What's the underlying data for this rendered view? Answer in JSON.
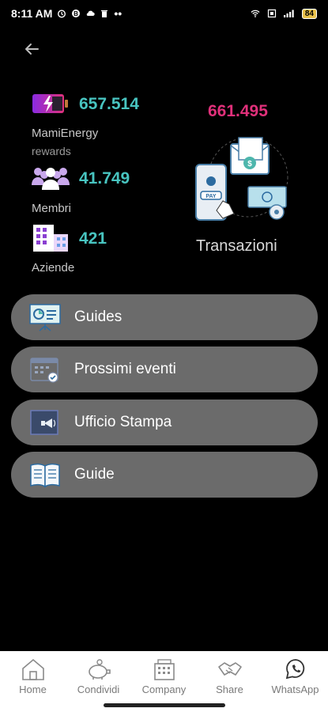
{
  "status": {
    "time": "8:11 AM",
    "battery": "84"
  },
  "stats": {
    "energy": {
      "value": "657.514",
      "label": "MamiEnergy",
      "sublabel": "rewards"
    },
    "members": {
      "value": "41.749",
      "label": "Membri"
    },
    "companies": {
      "value": "421",
      "label": "Aziende"
    }
  },
  "transactions": {
    "value": "661.495",
    "label": "Transazioni"
  },
  "menu": [
    {
      "label": "Guides",
      "icon": "presentation-board-icon"
    },
    {
      "label": "Prossimi eventi",
      "icon": "calendar-check-icon"
    },
    {
      "label": "Ufficio Stampa",
      "icon": "press-megaphone-icon"
    },
    {
      "label": "Guide",
      "icon": "open-book-icon"
    }
  ],
  "bottom_nav": [
    {
      "label": "Home",
      "icon": "home-icon"
    },
    {
      "label": "Condividi",
      "icon": "piggy-bank-icon"
    },
    {
      "label": "Company",
      "icon": "building-icon"
    },
    {
      "label": "Share",
      "icon": "handshake-icon"
    },
    {
      "label": "WhatsApp",
      "icon": "whatsapp-icon"
    }
  ],
  "colors": {
    "accent_teal": "#48c4c0",
    "accent_pink": "#e0307a",
    "menu_bg": "#6b6b6b"
  }
}
